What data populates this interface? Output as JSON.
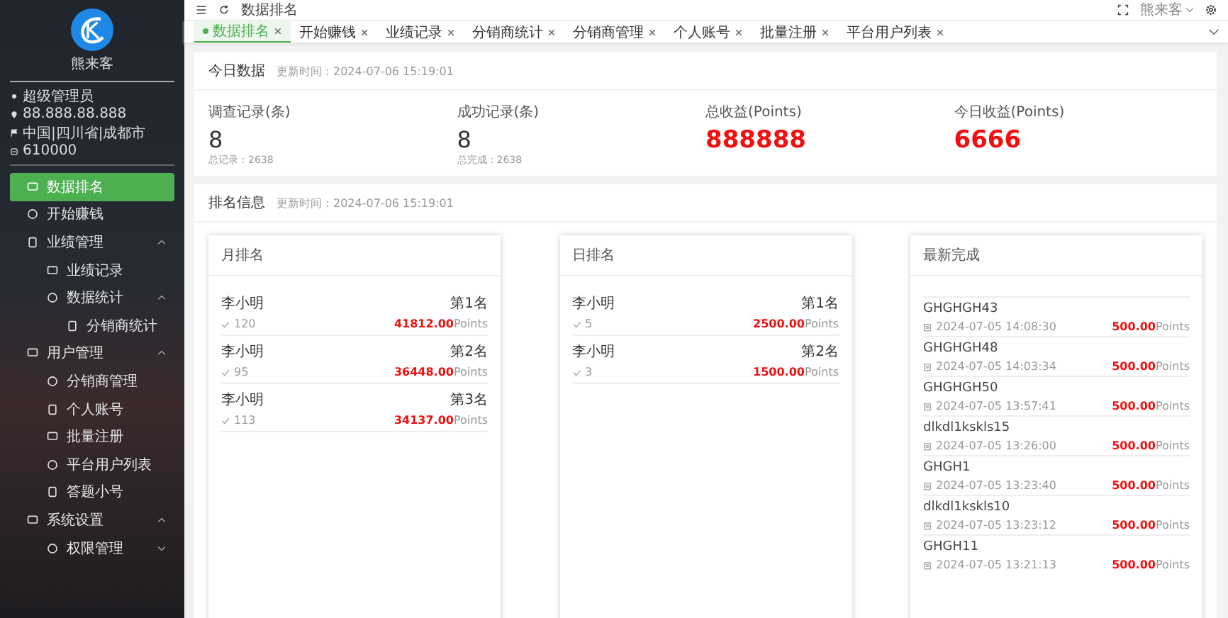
{
  "sidebar": {
    "brand": "熊来客",
    "user": {
      "role": "超级管理员",
      "ip": "88.888.88.888",
      "location": "中国|四川省|成都市",
      "postcode": "610000"
    },
    "menu": [
      {
        "label": "数据排名",
        "selected": true
      },
      {
        "label": "开始赚钱",
        "selected": false
      },
      {
        "label": "业绩管理",
        "selected": false,
        "expanded": true,
        "children": [
          {
            "label": "业绩记录",
            "selected": false
          },
          {
            "label": "数据统计",
            "selected": false,
            "expanded": true,
            "children": [
              {
                "label": "分销商统计",
                "selected": false
              }
            ]
          }
        ]
      },
      {
        "label": "用户管理",
        "selected": false,
        "expanded": true,
        "children": [
          {
            "label": "分销商管理",
            "selected": false
          },
          {
            "label": "个人账号",
            "selected": false
          },
          {
            "label": "批量注册",
            "selected": false
          },
          {
            "label": "平台用户列表",
            "selected": false
          },
          {
            "label": "答题小号",
            "selected": false
          }
        ]
      },
      {
        "label": "系统设置",
        "selected": false,
        "expanded": true,
        "children": [
          {
            "label": "权限管理",
            "selected": false,
            "expanded": false
          }
        ]
      }
    ]
  },
  "topbar": {
    "breadcrumb": "数据排名",
    "user": "熊来客"
  },
  "tabs": [
    {
      "label": "数据排名",
      "selected": true
    },
    {
      "label": "开始赚钱",
      "selected": false
    },
    {
      "label": "业绩记录",
      "selected": false
    },
    {
      "label": "分销商统计",
      "selected": false
    },
    {
      "label": "分销商管理",
      "selected": false
    },
    {
      "label": "个人账号",
      "selected": false
    },
    {
      "label": "批量注册",
      "selected": false
    },
    {
      "label": "平台用户列表",
      "selected": false
    }
  ],
  "today": {
    "title": "今日数据",
    "updated": "更新时间：2024-07-06 15:19:01",
    "stats": [
      {
        "kind": "count",
        "label": "调查记录(条)",
        "value": "8",
        "sub": "总记录：2638"
      },
      {
        "kind": "count",
        "label": "成功记录(条)",
        "value": "8",
        "sub": "总完成：2638"
      },
      {
        "kind": "money",
        "label": "总收益(Points)",
        "value": "888888"
      },
      {
        "kind": "money",
        "label": "今日收益(Points)",
        "value": "6666"
      }
    ]
  },
  "ranking": {
    "title": "排名信息",
    "updated": "更新时间：2024-07-06 15:19:01",
    "boards": [
      {
        "title": "月排名",
        "rows": [
          {
            "name": "李小明",
            "rank": "第1名",
            "count": "120",
            "amount": "41812.00",
            "unit": "Points"
          },
          {
            "name": "李小明",
            "rank": "第2名",
            "count": "95",
            "amount": "36448.00",
            "unit": "Points"
          },
          {
            "name": "李小明",
            "rank": "第3名",
            "count": "113",
            "amount": "34137.00",
            "unit": "Points"
          }
        ]
      },
      {
        "title": "日排名",
        "rows": [
          {
            "name": "李小明",
            "rank": "第1名",
            "count": "5",
            "amount": "2500.00",
            "unit": "Points"
          },
          {
            "name": "李小明",
            "rank": "第2名",
            "count": "3",
            "amount": "1500.00",
            "unit": "Points"
          }
        ]
      }
    ],
    "recent": {
      "title": "最新完成",
      "rows": [
        {
          "name": "GHGHGH43",
          "time": "2024-07-05 14:08:30",
          "amount": "500.00",
          "unit": "Points"
        },
        {
          "name": "GHGHGH48",
          "time": "2024-07-05 14:03:34",
          "amount": "500.00",
          "unit": "Points"
        },
        {
          "name": "GHGHGH50",
          "time": "2024-07-05 13:57:41",
          "amount": "500.00",
          "unit": "Points"
        },
        {
          "name": "dlkdl1kskls15",
          "time": "2024-07-05 13:26:00",
          "amount": "500.00",
          "unit": "Points"
        },
        {
          "name": "GHGH1",
          "time": "2024-07-05 13:23:40",
          "amount": "500.00",
          "unit": "Points"
        },
        {
          "name": "dlkdl1kskls10",
          "time": "2024-07-05 13:23:12",
          "amount": "500.00",
          "unit": "Points"
        },
        {
          "name": "GHGH11",
          "time": "2024-07-05 13:21:13",
          "amount": "500.00",
          "unit": "Points"
        }
      ]
    }
  }
}
